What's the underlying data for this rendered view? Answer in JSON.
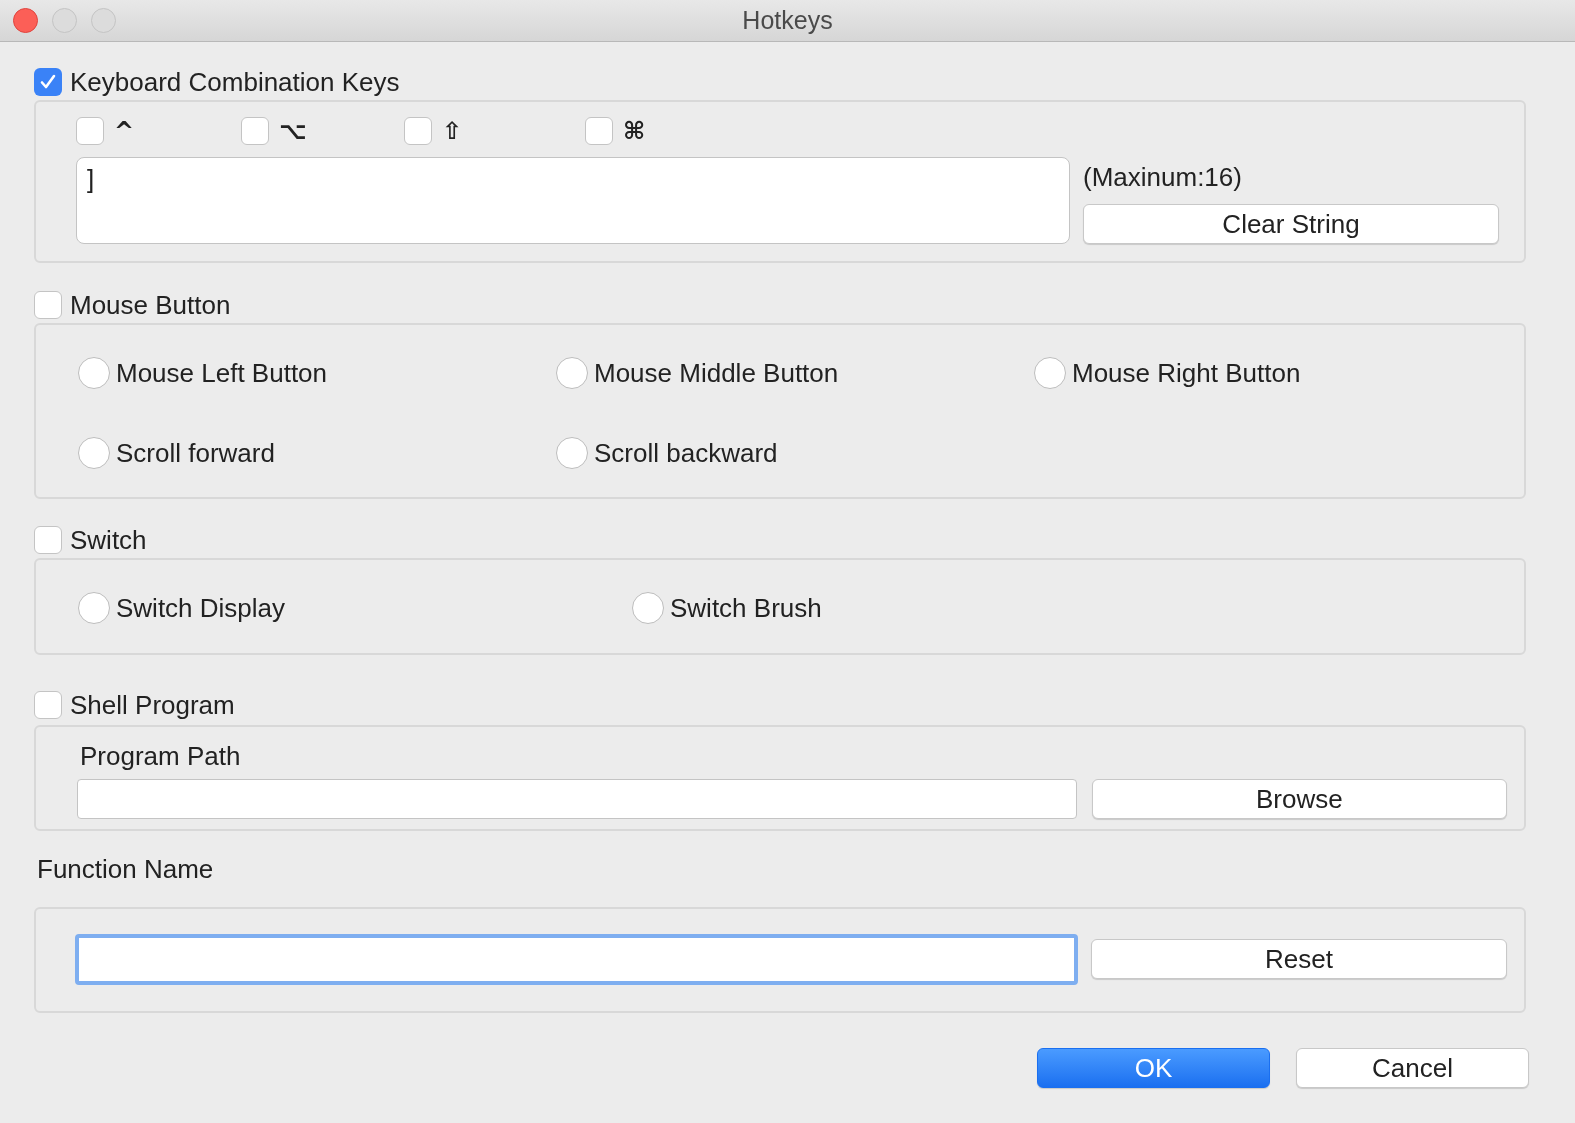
{
  "window": {
    "title": "Hotkeys"
  },
  "keyboard": {
    "label": "Keyboard Combination Keys",
    "checked": true,
    "modifiers": [
      {
        "symbol": "^",
        "checked": false
      },
      {
        "symbol": "⌥",
        "checked": false
      },
      {
        "symbol": "⇧",
        "checked": false
      },
      {
        "symbol": "⌘",
        "checked": false
      }
    ],
    "value": "]",
    "limit": "(Maxinum:16)",
    "clear_button": "Clear String"
  },
  "mouse": {
    "label": "Mouse Button",
    "checked": false,
    "options": [
      {
        "label": "Mouse Left Button",
        "selected": false
      },
      {
        "label": "Mouse Middle Button",
        "selected": false
      },
      {
        "label": "Mouse Right Button",
        "selected": false
      },
      {
        "label": "Scroll forward",
        "selected": false
      },
      {
        "label": "Scroll backward",
        "selected": false
      }
    ]
  },
  "switch": {
    "label": "Switch",
    "checked": false,
    "options": [
      {
        "label": "Switch Display",
        "selected": false
      },
      {
        "label": "Switch Brush",
        "selected": false
      }
    ]
  },
  "shell": {
    "label": "Shell Program",
    "checked": false,
    "path_label": "Program Path",
    "browse_button": "Browse"
  },
  "function_name": {
    "label": "Function Name",
    "focused": true,
    "reset_button": "Reset"
  },
  "buttons": [
    {
      "label": "OK",
      "kind": "primary"
    },
    {
      "label": "Cancel",
      "kind": "secondary"
    }
  ]
}
